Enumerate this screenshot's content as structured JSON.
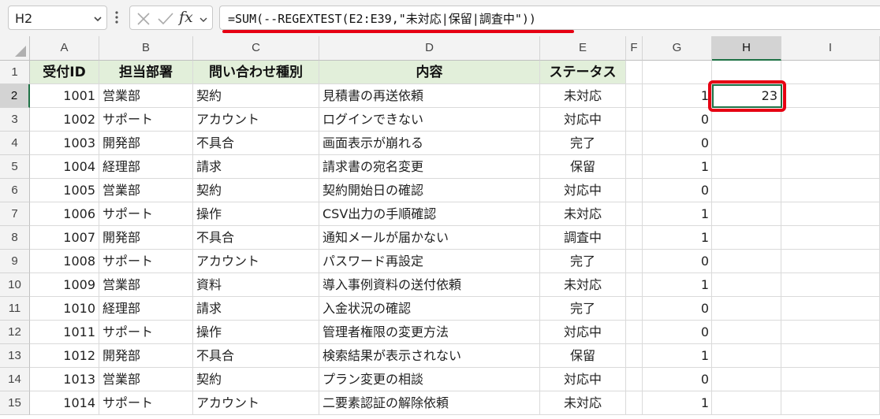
{
  "formula_bar": {
    "name_box": "H2",
    "fx_label": "fx",
    "formula": "=SUM(--REGEXTEST(E2:E39,\"未対応|保留|調査中\"))"
  },
  "columns": [
    "A",
    "B",
    "C",
    "D",
    "E",
    "F",
    "G",
    "H",
    "I"
  ],
  "selected_column": "H",
  "selected_row": "2",
  "headers": {
    "a": "受付ID",
    "b": "担当部署",
    "c": "問い合わせ種別",
    "d": "内容",
    "e": "ステータス"
  },
  "result_cell": "23",
  "rows": [
    {
      "num": "2",
      "id": "1001",
      "dept": "営業部",
      "type": "契約",
      "content": "見積書の再送依頼",
      "status": "未対応",
      "g": "1"
    },
    {
      "num": "3",
      "id": "1002",
      "dept": "サポート",
      "type": "アカウント",
      "content": "ログインできない",
      "status": "対応中",
      "g": "0"
    },
    {
      "num": "4",
      "id": "1003",
      "dept": "開発部",
      "type": "不具合",
      "content": "画面表示が崩れる",
      "status": "完了",
      "g": "0"
    },
    {
      "num": "5",
      "id": "1004",
      "dept": "経理部",
      "type": "請求",
      "content": "請求書の宛名変更",
      "status": "保留",
      "g": "1"
    },
    {
      "num": "6",
      "id": "1005",
      "dept": "営業部",
      "type": "契約",
      "content": "契約開始日の確認",
      "status": "対応中",
      "g": "0"
    },
    {
      "num": "7",
      "id": "1006",
      "dept": "サポート",
      "type": "操作",
      "content": "CSV出力の手順確認",
      "status": "未対応",
      "g": "1"
    },
    {
      "num": "8",
      "id": "1007",
      "dept": "開発部",
      "type": "不具合",
      "content": "通知メールが届かない",
      "status": "調査中",
      "g": "1"
    },
    {
      "num": "9",
      "id": "1008",
      "dept": "サポート",
      "type": "アカウント",
      "content": "パスワード再設定",
      "status": "完了",
      "g": "0"
    },
    {
      "num": "10",
      "id": "1009",
      "dept": "営業部",
      "type": "資料",
      "content": "導入事例資料の送付依頼",
      "status": "未対応",
      "g": "1"
    },
    {
      "num": "11",
      "id": "1010",
      "dept": "経理部",
      "type": "請求",
      "content": "入金状況の確認",
      "status": "完了",
      "g": "0"
    },
    {
      "num": "12",
      "id": "1011",
      "dept": "サポート",
      "type": "操作",
      "content": "管理者権限の変更方法",
      "status": "対応中",
      "g": "0"
    },
    {
      "num": "13",
      "id": "1012",
      "dept": "開発部",
      "type": "不具合",
      "content": "検索結果が表示されない",
      "status": "保留",
      "g": "1"
    },
    {
      "num": "14",
      "id": "1013",
      "dept": "営業部",
      "type": "契約",
      "content": "プラン変更の相談",
      "status": "対応中",
      "g": "0"
    },
    {
      "num": "15",
      "id": "1014",
      "dept": "サポート",
      "type": "アカウント",
      "content": "二要素認証の解除依頼",
      "status": "未対応",
      "g": "1"
    }
  ],
  "colors": {
    "header_fill": "#e2efda",
    "selection": "#1e7145",
    "annotation": "#e60012"
  }
}
